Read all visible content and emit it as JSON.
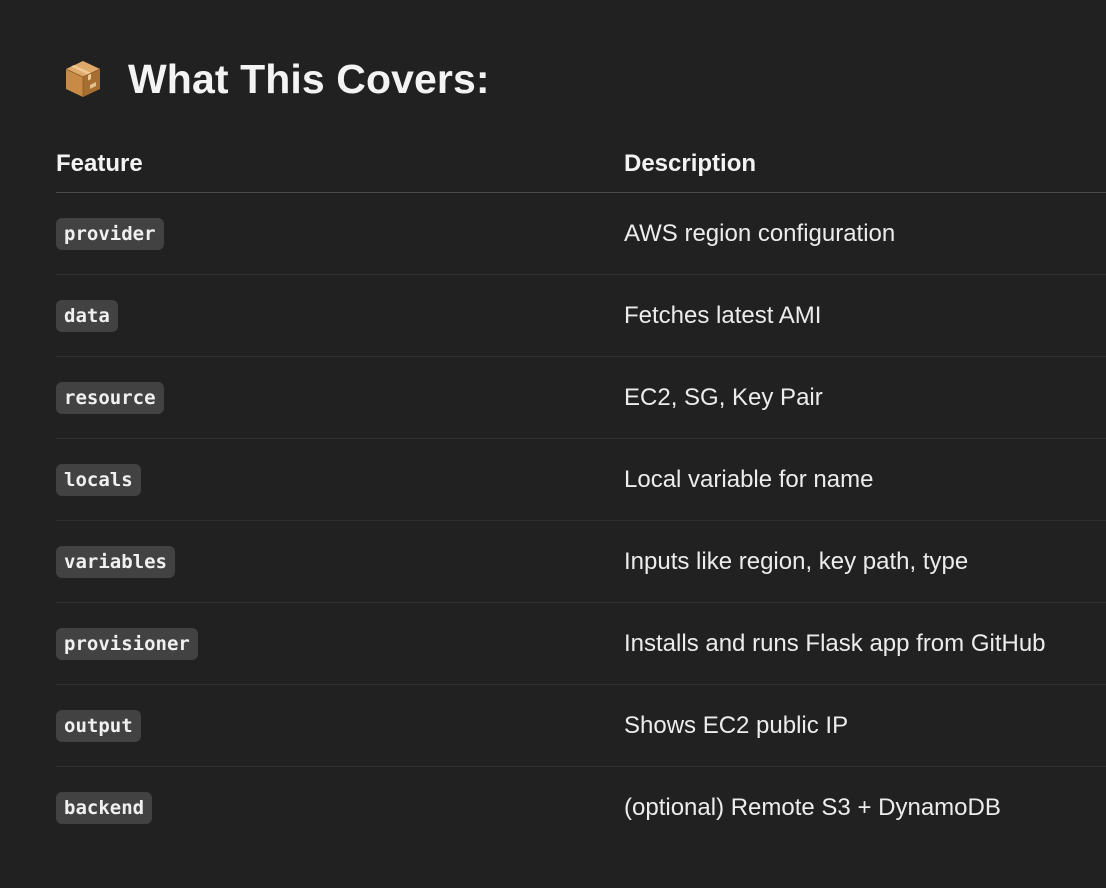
{
  "section": {
    "icon": "package-icon",
    "title": "What This Covers:"
  },
  "table": {
    "headers": {
      "feature": "Feature",
      "description": "Description"
    },
    "rows": [
      {
        "feature": "provider",
        "description": "AWS region configuration"
      },
      {
        "feature": "data",
        "description": "Fetches latest AMI"
      },
      {
        "feature": "resource",
        "description": "EC2, SG, Key Pair"
      },
      {
        "feature": "locals",
        "description": "Local variable for name"
      },
      {
        "feature": "variables",
        "description": "Inputs like region, key path, type"
      },
      {
        "feature": "provisioner",
        "description": "Installs and runs Flask app from GitHub"
      },
      {
        "feature": "output",
        "description": "Shows EC2 public IP"
      },
      {
        "feature": "backend",
        "description": "(optional) Remote S3 + DynamoDB"
      }
    ]
  },
  "colors": {
    "background": "#212121",
    "text": "#ececec",
    "code_background": "#424242",
    "divider": "#4a4a4a"
  }
}
